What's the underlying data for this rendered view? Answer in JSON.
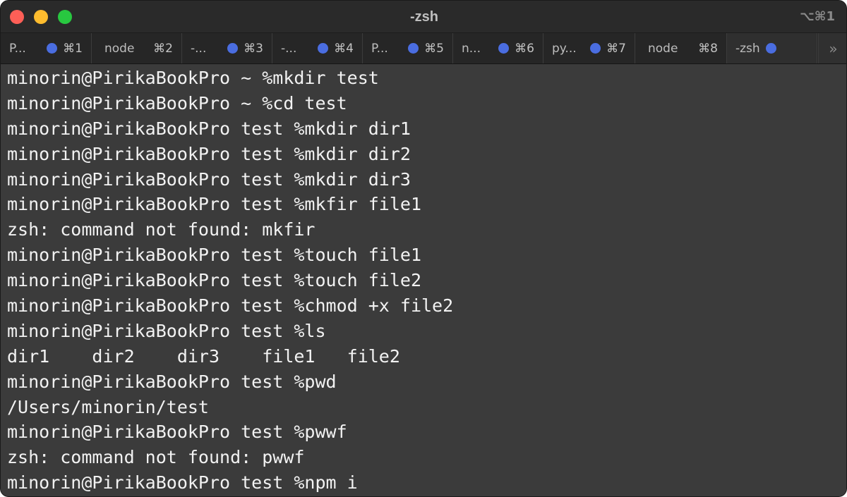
{
  "window": {
    "title": "-zsh",
    "shortcut": "⌥⌘1"
  },
  "tabs": [
    {
      "label": "P...",
      "dot": true,
      "shortcut": "⌘1"
    },
    {
      "label": "node",
      "dot": false,
      "shortcut": "⌘2"
    },
    {
      "label": "-...",
      "dot": true,
      "shortcut": "⌘3"
    },
    {
      "label": "-...",
      "dot": true,
      "shortcut": "⌘4"
    },
    {
      "label": "P...",
      "dot": true,
      "shortcut": "⌘5"
    },
    {
      "label": "n...",
      "dot": true,
      "shortcut": "⌘6"
    },
    {
      "label": "py...",
      "dot": true,
      "shortcut": "⌘7"
    },
    {
      "label": "node",
      "dot": false,
      "shortcut": "⌘8"
    },
    {
      "label": "-zsh",
      "dot": true,
      "shortcut": ""
    }
  ],
  "tab_overflow_icon": "»",
  "terminal": {
    "lines": [
      "minorin@PirikaBookPro ~ %mkdir test",
      "minorin@PirikaBookPro ~ %cd test",
      "minorin@PirikaBookPro test %mkdir dir1",
      "minorin@PirikaBookPro test %mkdir dir2",
      "minorin@PirikaBookPro test %mkdir dir3",
      "minorin@PirikaBookPro test %mkfir file1",
      "zsh: command not found: mkfir",
      "minorin@PirikaBookPro test %touch file1",
      "minorin@PirikaBookPro test %touch file2",
      "minorin@PirikaBookPro test %chmod +x file2",
      "minorin@PirikaBookPro test %ls",
      "dir1    dir2    dir3    file1   file2",
      "minorin@PirikaBookPro test %pwd",
      "/Users/minorin/test",
      "minorin@PirikaBookPro test %pwwf",
      "zsh: command not found: pwwf",
      "minorin@PirikaBookPro test %npm i"
    ]
  },
  "colors": {
    "close": "#fe5f57",
    "minimize": "#febc2e",
    "zoom": "#28c840",
    "tab_dot": "#4a6de0",
    "terminal_bg": "#3b3b3b",
    "terminal_fg": "#f2f2f2"
  }
}
